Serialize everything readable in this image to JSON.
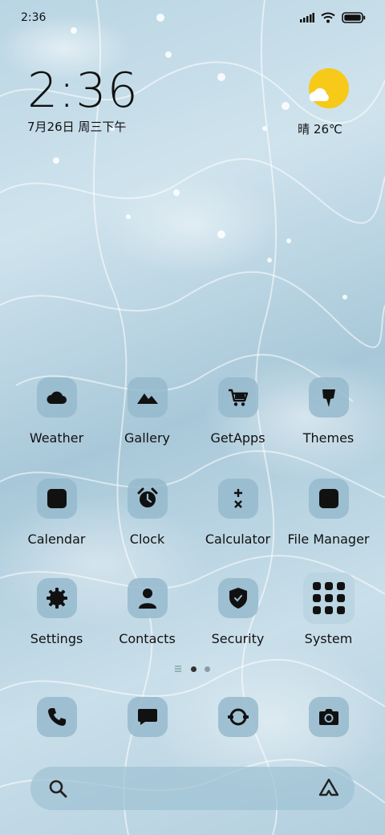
{
  "status_bar": {
    "time": "2:36"
  },
  "clock_widget": {
    "time": "2:36",
    "date": "7月26日 周三下午"
  },
  "weather_widget": {
    "condition_temp": "晴 26℃",
    "icon": "sun-cloud-icon",
    "sun_color": "#f7c919"
  },
  "apps": [
    {
      "label": "Weather",
      "icon": "cloud-icon"
    },
    {
      "label": "Gallery",
      "icon": "mountain-icon"
    },
    {
      "label": "GetApps",
      "icon": "cart-icon"
    },
    {
      "label": "Themes",
      "icon": "brush-icon"
    },
    {
      "label": "Calendar",
      "icon": "calendar-icon"
    },
    {
      "label": "Clock",
      "icon": "alarm-clock-icon"
    },
    {
      "label": "Calculator",
      "icon": "calculator-icon"
    },
    {
      "label": "File Manager",
      "icon": "folder-icon"
    },
    {
      "label": "Settings",
      "icon": "gear-icon"
    },
    {
      "label": "Contacts",
      "icon": "person-icon"
    },
    {
      "label": "Security",
      "icon": "shield-icon"
    },
    {
      "label": "System",
      "icon": "folder-grid-icon"
    }
  ],
  "page_indicator": {
    "pages": 2,
    "current": 1
  },
  "dock": [
    {
      "icon": "phone-icon"
    },
    {
      "icon": "message-icon"
    },
    {
      "icon": "browser-icon"
    },
    {
      "icon": "camera-icon"
    }
  ],
  "search_bar": {
    "left_icon": "search-icon",
    "right_icon": "assistant-icon"
  },
  "colors": {
    "tile": "#95bacc",
    "text": "#111111"
  }
}
